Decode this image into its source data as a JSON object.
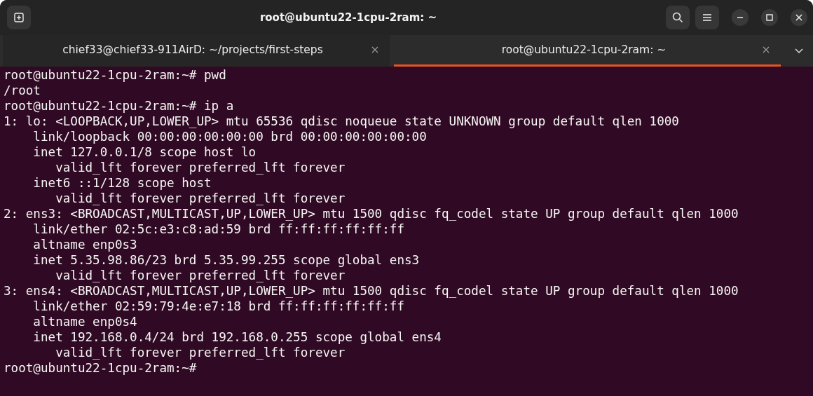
{
  "window": {
    "title": "root@ubuntu22-1cpu-2ram: ~"
  },
  "tabs": [
    {
      "label": "chief33@chief33-911AirD: ~/projects/first-steps",
      "selected": false
    },
    {
      "label": "root@ubuntu22-1cpu-2ram: ~",
      "selected": true
    }
  ],
  "terminal": {
    "lines": [
      "root@ubuntu22-1cpu-2ram:~# pwd",
      "/root",
      "root@ubuntu22-1cpu-2ram:~# ip a",
      "1: lo: <LOOPBACK,UP,LOWER_UP> mtu 65536 qdisc noqueue state UNKNOWN group default qlen 1000",
      "    link/loopback 00:00:00:00:00:00 brd 00:00:00:00:00:00",
      "    inet 127.0.0.1/8 scope host lo",
      "       valid_lft forever preferred_lft forever",
      "    inet6 ::1/128 scope host",
      "       valid_lft forever preferred_lft forever",
      "2: ens3: <BROADCAST,MULTICAST,UP,LOWER_UP> mtu 1500 qdisc fq_codel state UP group default qlen 1000",
      "    link/ether 02:5c:e3:c8:ad:59 brd ff:ff:ff:ff:ff:ff",
      "    altname enp0s3",
      "    inet 5.35.98.86/23 brd 5.35.99.255 scope global ens3",
      "       valid_lft forever preferred_lft forever",
      "3: ens4: <BROADCAST,MULTICAST,UP,LOWER_UP> mtu 1500 qdisc fq_codel state UP group default qlen 1000",
      "    link/ether 02:59:79:4e:e7:18 brd ff:ff:ff:ff:ff:ff",
      "    altname enp0s4",
      "    inet 192.168.0.4/24 brd 192.168.0.255 scope global ens4",
      "       valid_lft forever preferred_lft forever",
      "root@ubuntu22-1cpu-2ram:~#"
    ]
  }
}
